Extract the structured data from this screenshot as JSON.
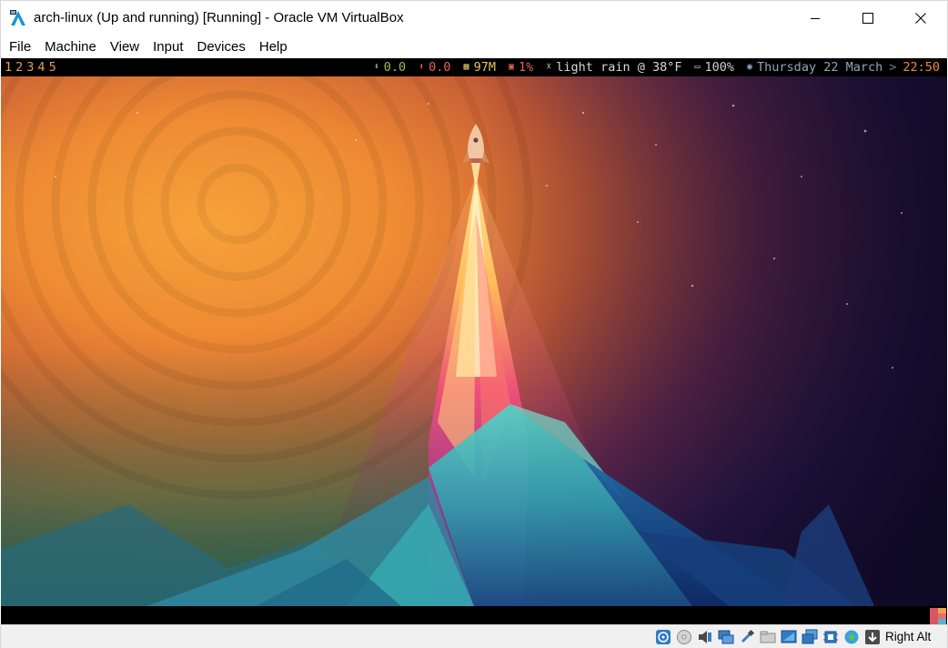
{
  "window": {
    "title": "arch-linux (Up and running) [Running] - Oracle VM VirtualBox",
    "icon": "virtualbox-arch-icon",
    "controls": [
      "minimize-icon",
      "maximize-icon",
      "close-icon"
    ]
  },
  "menu": {
    "items": [
      "File",
      "Machine",
      "View",
      "Input",
      "Devices",
      "Help"
    ]
  },
  "guest": {
    "statusbar": {
      "workspaces": [
        "1",
        "2",
        "3",
        "4",
        "5"
      ],
      "net_down": "0.0",
      "net_up": "0.0",
      "memory": "97M",
      "cpu": "1%",
      "weather": "light rain @ 38°F",
      "battery": "100%",
      "date": "Thursday 22 March",
      "separator": ">",
      "time": "22:50"
    },
    "wallpaper": "rocket-launch-polygon-wallpaper"
  },
  "vbox_status": {
    "icons": [
      "hard-disk-icon",
      "optical-drive-icon",
      "audio-icon",
      "network-icon",
      "usb-icon",
      "shared-folders-icon",
      "display-icon",
      "video-capture-icon",
      "cpu-icon",
      "mouse-integration-icon",
      "keyboard-capture-icon"
    ],
    "host_key": "Right Alt"
  },
  "colors": {
    "workspace_active": "#ff9d3a",
    "net_down": "#9bbf55",
    "net_up": "#e8605a",
    "memory": "#e5c26a",
    "date": "#8fa4bf",
    "time": "#f08a3c"
  }
}
